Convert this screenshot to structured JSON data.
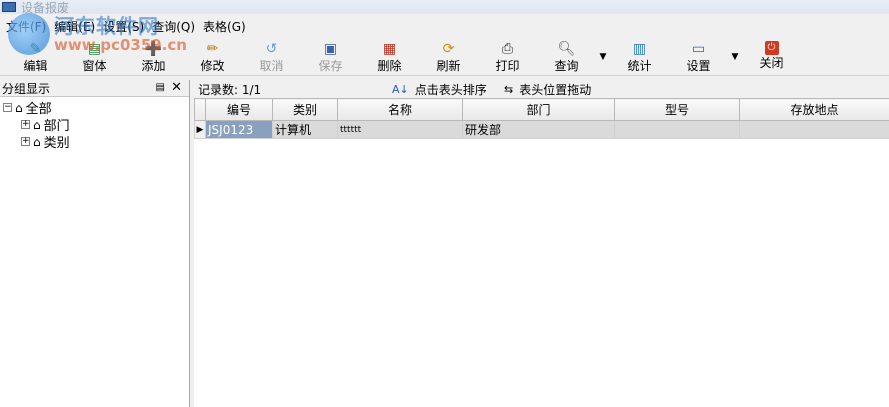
{
  "window": {
    "title": "设备报废"
  },
  "menu": [
    {
      "label": "文件(F)"
    },
    {
      "label": "编辑(E)"
    },
    {
      "label": "设置(S)"
    },
    {
      "label": "查询(Q)"
    },
    {
      "label": "表格(G)"
    }
  ],
  "watermark": {
    "line1": "河东软件网",
    "line2": "www.pc0359.cn"
  },
  "toolbar": {
    "items": [
      {
        "label": "编辑",
        "icon": "edit-icon"
      },
      {
        "label": "窗体",
        "icon": "window-icon"
      },
      {
        "label": "添加",
        "icon": "add-icon"
      },
      {
        "label": "修改",
        "icon": "modify-icon"
      },
      {
        "label": "取消",
        "icon": "undo-icon"
      },
      {
        "label": "保存",
        "icon": "save-icon"
      },
      {
        "label": "删除",
        "icon": "delete-icon"
      },
      {
        "label": "刷新",
        "icon": "refresh-icon"
      },
      {
        "label": "打印",
        "icon": "print-icon"
      },
      {
        "label": "查询",
        "icon": "search-icon"
      },
      {
        "label": "统计",
        "icon": "chart-icon"
      },
      {
        "label": "设置",
        "icon": "settings-icon"
      },
      {
        "label": "关闭",
        "icon": "power-icon"
      }
    ]
  },
  "sidebar": {
    "title": "分组显示",
    "tree": [
      {
        "label": "全部"
      },
      {
        "label": "部门"
      },
      {
        "label": "类别"
      }
    ]
  },
  "main": {
    "record_count": "记录数: 1/1",
    "sort_hint": "点击表头排序",
    "drag_hint": "表头位置拖动"
  },
  "table": {
    "columns": [
      "编号",
      "类别",
      "名称",
      "部门",
      "型号",
      "存放地点"
    ],
    "rows": [
      [
        "JSJ0123",
        "计算机",
        "tttttt",
        "研发部",
        "",
        ""
      ]
    ]
  },
  "colors": {
    "selected_cell": "#8aa0c0",
    "grid_row": "#dadada"
  }
}
